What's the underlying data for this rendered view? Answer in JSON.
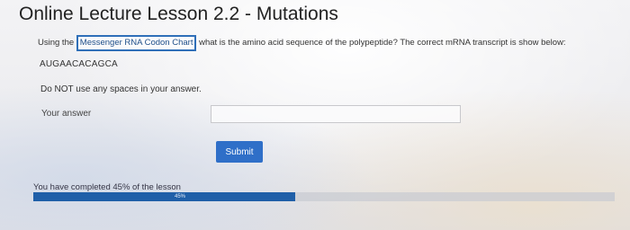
{
  "lesson": {
    "title": "Online Lecture Lesson 2.2 - Mutations"
  },
  "question": {
    "prefix": "Using the",
    "link_label": "Messenger RNA Codon Chart",
    "suffix": "what is the amino acid sequence of the polypeptide? The correct mRNA transcript is show below:",
    "transcript": "AUGAACACAGCA",
    "instruction": "Do NOT use any spaces in your answer."
  },
  "answer": {
    "label": "Your answer",
    "value": "",
    "placeholder": ""
  },
  "submit": {
    "label": "Submit"
  },
  "progress": {
    "text": "You have completed 45% of the lesson",
    "percent": 45,
    "label": "45%"
  },
  "colors": {
    "accent": "#2f6fc8",
    "progress_fill": "#1f5fa8"
  }
}
